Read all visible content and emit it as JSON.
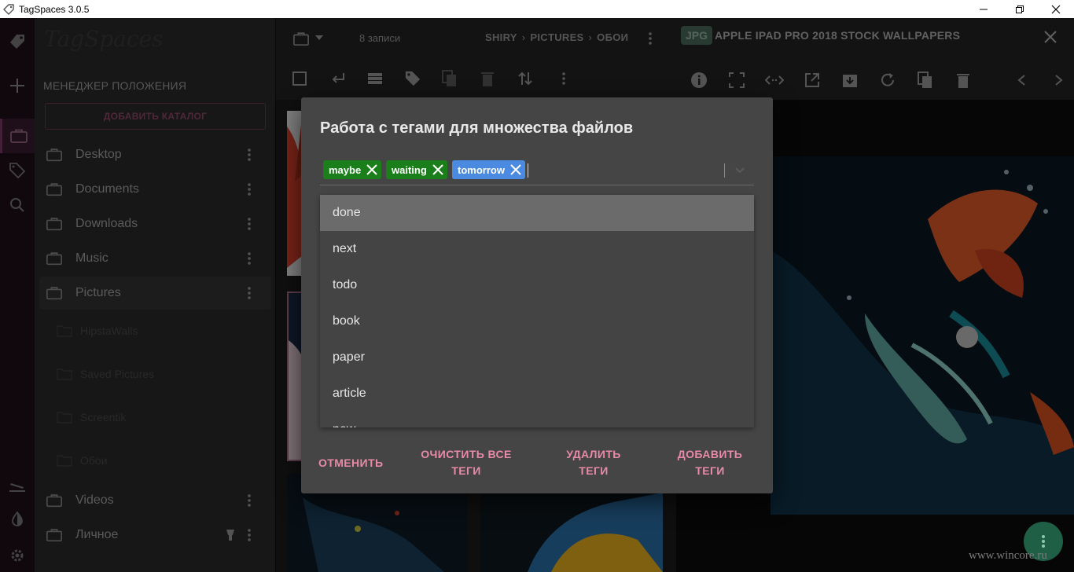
{
  "window": {
    "title": "TagSpaces 3.0.5"
  },
  "sidebar": {
    "logo": "TagSpaces",
    "heading": "МЕНЕДЖЕР ПОЛОЖЕНИЯ",
    "add_catalog_label": "ДОБАВИТЬ КАТАЛОГ",
    "locations": [
      {
        "label": "Desktop"
      },
      {
        "label": "Documents"
      },
      {
        "label": "Downloads"
      },
      {
        "label": "Music"
      },
      {
        "label": "Pictures",
        "selected": true
      },
      {
        "label": "Videos"
      },
      {
        "label": "Личное"
      }
    ],
    "subfolders": [
      {
        "label": "HipstaWalls"
      },
      {
        "label": "Saved Pictures"
      },
      {
        "label": "Screentik"
      },
      {
        "label": "Обои"
      }
    ]
  },
  "filearea": {
    "count": "8 записи",
    "breadcrumb": [
      "SHIRY",
      "PICTURES",
      "ОБОИ"
    ]
  },
  "preview": {
    "badge": "JPG",
    "title": "APPLE IPAD PRO 2018 STOCK WALLPAPERS"
  },
  "dialog": {
    "title": "Работа с тегами для множества файлов",
    "chips": [
      {
        "label": "maybe",
        "color": "#1a7f1a"
      },
      {
        "label": "waiting",
        "color": "#1a7f1a"
      },
      {
        "label": "tomorrow",
        "color": "#4a8ae0"
      }
    ],
    "options": [
      "done",
      "next",
      "todo",
      "book",
      "paper",
      "article",
      "new"
    ],
    "buttons": {
      "cancel_label": "ОТМЕНИТЬ",
      "clear_line1": "ОЧИСТИТЬ ВСЕ",
      "clear_line2": "ТЕГИ",
      "remove_line1": "УДАЛИТЬ",
      "remove_line2": "ТЕГИ",
      "add_line1": "ДОБАВИТЬ",
      "add_line2": "ТЕГИ"
    }
  },
  "watermark": "www.wincore.ru",
  "colors": {
    "accent": "#e88aa8",
    "tag_green": "#1a7f1a",
    "tag_blue": "#4a8ae0",
    "rail": "#1f0f1a"
  }
}
